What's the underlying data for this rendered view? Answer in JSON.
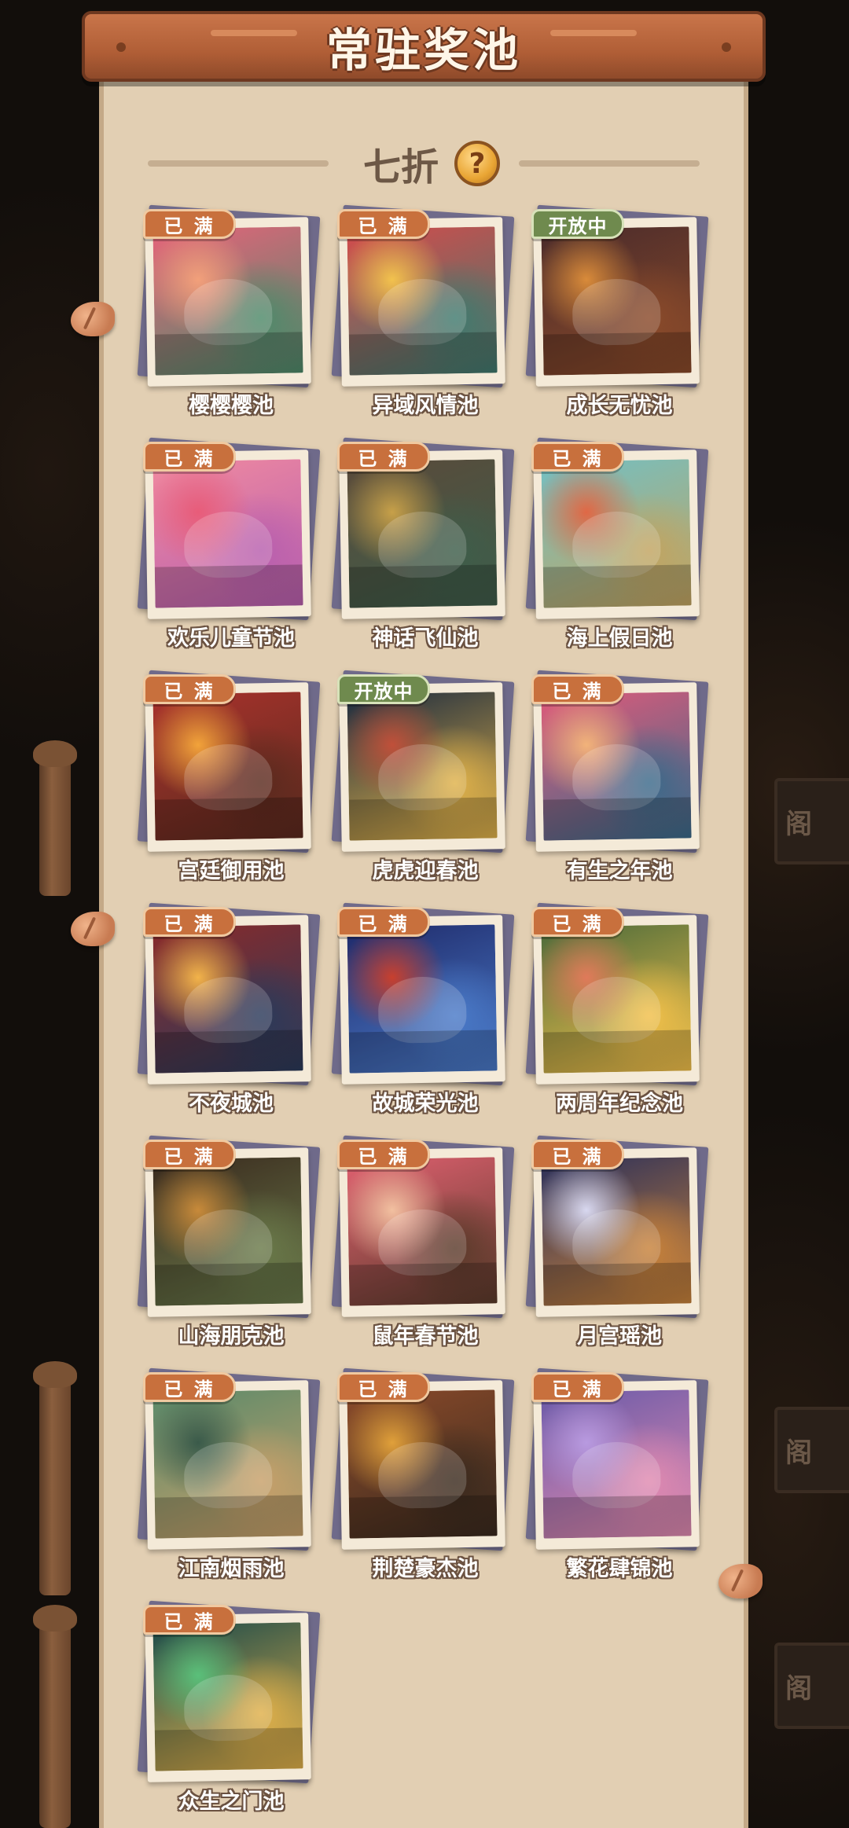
{
  "title": "常驻奖池",
  "discount_label": "七折",
  "help_icon": "?",
  "background_sign_text": "阁",
  "pools": [
    {
      "name": "樱樱樱池",
      "status": "已 满",
      "status_type": "full",
      "colors": [
        "#e7637a",
        "#f2a07a",
        "#4d8a6a"
      ]
    },
    {
      "name": "异域风情池",
      "status": "已 满",
      "status_type": "full",
      "colors": [
        "#d54b4b",
        "#f2c24d",
        "#3f7a6e"
      ]
    },
    {
      "name": "成长无忧池",
      "status": "开放中",
      "status_type": "open",
      "colors": [
        "#4a2b2b",
        "#d98b3a",
        "#8a4a2a"
      ]
    },
    {
      "name": "欢乐儿童节池",
      "status": "已 满",
      "status_type": "full",
      "colors": [
        "#f08aa0",
        "#e85c79",
        "#b85fae"
      ]
    },
    {
      "name": "神话飞仙池",
      "status": "已 满",
      "status_type": "full",
      "colors": [
        "#5a4a3a",
        "#c7a049",
        "#3e5d4a"
      ]
    },
    {
      "name": "海上假日池",
      "status": "已 满",
      "status_type": "full",
      "colors": [
        "#72c0c4",
        "#e06845",
        "#c2a460"
      ]
    },
    {
      "name": "宫廷御用池",
      "status": "已 满",
      "status_type": "full",
      "colors": [
        "#a9322c",
        "#f2a33a",
        "#5a2a1e"
      ]
    },
    {
      "name": "虎虎迎春池",
      "status": "开放中",
      "status_type": "open",
      "colors": [
        "#1c2b3f",
        "#c0503a",
        "#e0b24a"
      ]
    },
    {
      "name": "有生之年池",
      "status": "已 满",
      "status_type": "full",
      "colors": [
        "#e05a7a",
        "#f2b37a",
        "#3a6a8a"
      ]
    },
    {
      "name": "不夜城池",
      "status": "已 满",
      "status_type": "full",
      "colors": [
        "#8a2a2a",
        "#f2b34a",
        "#2a3a5a"
      ]
    },
    {
      "name": "故城荣光池",
      "status": "已 满",
      "status_type": "full",
      "colors": [
        "#1f2a6a",
        "#c8402e",
        "#4a7ac8"
      ]
    },
    {
      "name": "两周年纪念池",
      "status": "已 满",
      "status_type": "full",
      "colors": [
        "#4a6a3a",
        "#e07a5a",
        "#f2c04a"
      ]
    },
    {
      "name": "山海朋克池",
      "status": "已 满",
      "status_type": "full",
      "colors": [
        "#3a2a1e",
        "#c88a3a",
        "#6a7a4a"
      ]
    },
    {
      "name": "鼠年春节池",
      "status": "已 满",
      "status_type": "full",
      "colors": [
        "#e06070",
        "#f2c0a0",
        "#5a3a2a"
      ]
    },
    {
      "name": "月宫瑶池",
      "status": "已 满",
      "status_type": "full",
      "colors": [
        "#2a2f5a",
        "#d8d8f0",
        "#c8823a"
      ]
    },
    {
      "name": "江南烟雨池",
      "status": "已 满",
      "status_type": "full",
      "colors": [
        "#5a8a6a",
        "#3a5a4a",
        "#c8a06a"
      ]
    },
    {
      "name": "荆楚豪杰池",
      "status": "已 满",
      "status_type": "full",
      "colors": [
        "#8a4a2a",
        "#e0a03a",
        "#3a2a1e"
      ]
    },
    {
      "name": "繁花肆锦池",
      "status": "已 满",
      "status_type": "full",
      "colors": [
        "#6a5aa8",
        "#b89ae0",
        "#e08ab0"
      ]
    },
    {
      "name": "众生之门池",
      "status": "已 满",
      "status_type": "full",
      "colors": [
        "#1a4a4a",
        "#5ac07a",
        "#e0b04a"
      ]
    }
  ]
}
